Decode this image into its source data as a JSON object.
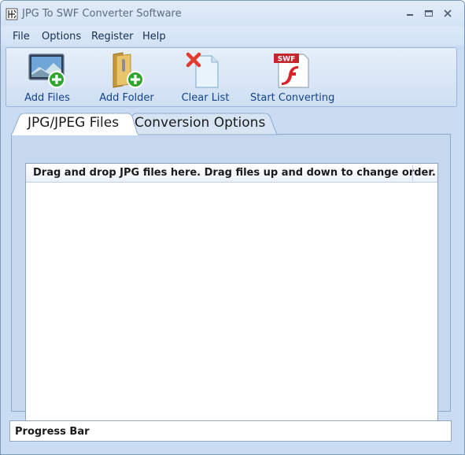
{
  "window": {
    "title": "JPG To SWF Converter Software",
    "accent_color": "#c9dcf2",
    "title_text_color": "#5a6c84"
  },
  "titlebar_buttons": {
    "minimize_icon": "minimize-icon",
    "maximize_icon": "maximize-icon",
    "close_icon": "close-icon"
  },
  "menu": {
    "items": [
      {
        "label": "File"
      },
      {
        "label": "Options"
      },
      {
        "label": "Register"
      },
      {
        "label": "Help"
      }
    ]
  },
  "toolbar": {
    "buttons": [
      {
        "label": "Add Files",
        "icon": "add-image-icon"
      },
      {
        "label": "Add Folder",
        "icon": "add-folder-icon"
      },
      {
        "label": "Clear List",
        "icon": "clear-list-icon"
      },
      {
        "label": "Start Converting",
        "icon": "swf-flash-icon"
      }
    ],
    "label_color": "#15428b"
  },
  "tabs": [
    {
      "label": "JPG/JPEG Files",
      "active": true
    },
    {
      "label": "Conversion Options",
      "active": false
    }
  ],
  "file_list": {
    "header": "Drag and drop JPG files here. Drag files up and down to change order.",
    "rows": []
  },
  "progress": {
    "label": "Progress Bar",
    "value": 0
  }
}
